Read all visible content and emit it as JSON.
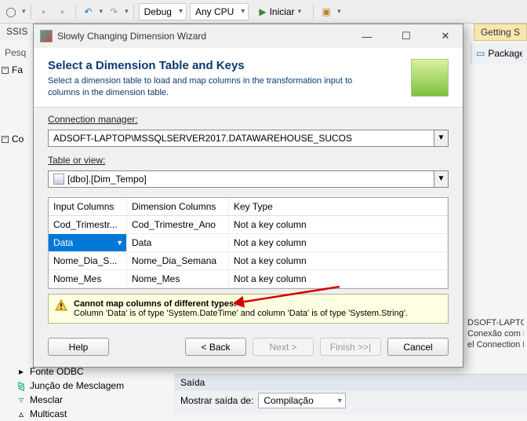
{
  "ide": {
    "config_label": "Debug",
    "platform_label": "Any CPU",
    "start_label": "Iniciar",
    "ssis_tab": "SSIS",
    "getting_started": "Getting S",
    "package_label": "Package E",
    "pesq_label": "Pesq"
  },
  "left_tree": {
    "fa": "Fa",
    "co": "Co"
  },
  "tree_items": {
    "i0": "Fonte ODBC",
    "i1": "Junção de Mesclagem",
    "i2": "Mesclar",
    "i3": "Multicast"
  },
  "right_status": {
    "l0": "DSOFT-LAPTOP\\",
    "l1": "Conexão com D",
    "l2": "el Connection Ma"
  },
  "output": {
    "header": "Saída",
    "label": "Mostrar saída de:",
    "combo": "Compilação"
  },
  "dialog": {
    "title": "Slowly Changing Dimension Wizard",
    "heading": "Select a Dimension Table and Keys",
    "subheading": "Select a dimension table to load and map columns in the transformation input to columns in the dimension table.",
    "conn_label": "Connection manager:",
    "conn_value": "ADSOFT-LAPTOP\\MSSQLSERVER2017.DATAWAREHOUSE_SUCOS",
    "table_label": "Table or view:",
    "table_value": "[dbo].[Dim_Tempo]",
    "grid": {
      "h1": "Input Columns",
      "h2": "Dimension Columns",
      "h3": "Key Type",
      "rows": [
        {
          "c1": "Cod_Trimestr...",
          "c2": "Cod_Trimestre_Ano",
          "c3": "Not a key column"
        },
        {
          "c1": "Data",
          "c2": "Data",
          "c3": "Not a key column",
          "selected": true
        },
        {
          "c1": "Nome_Dia_S...",
          "c2": "Nome_Dia_Semana",
          "c3": "Not a key column"
        },
        {
          "c1": "Nome_Mes",
          "c2": "Nome_Mes",
          "c3": "Not a key column"
        }
      ]
    },
    "warning": {
      "line1": "Cannot map columns of different types.",
      "line2": "Column 'Data' is of type 'System.DateTime' and column 'Data' is of type 'System.String'."
    },
    "buttons": {
      "help": "Help",
      "back": "< Back",
      "next": "Next >",
      "finish": "Finish >>|",
      "cancel": "Cancel"
    }
  }
}
